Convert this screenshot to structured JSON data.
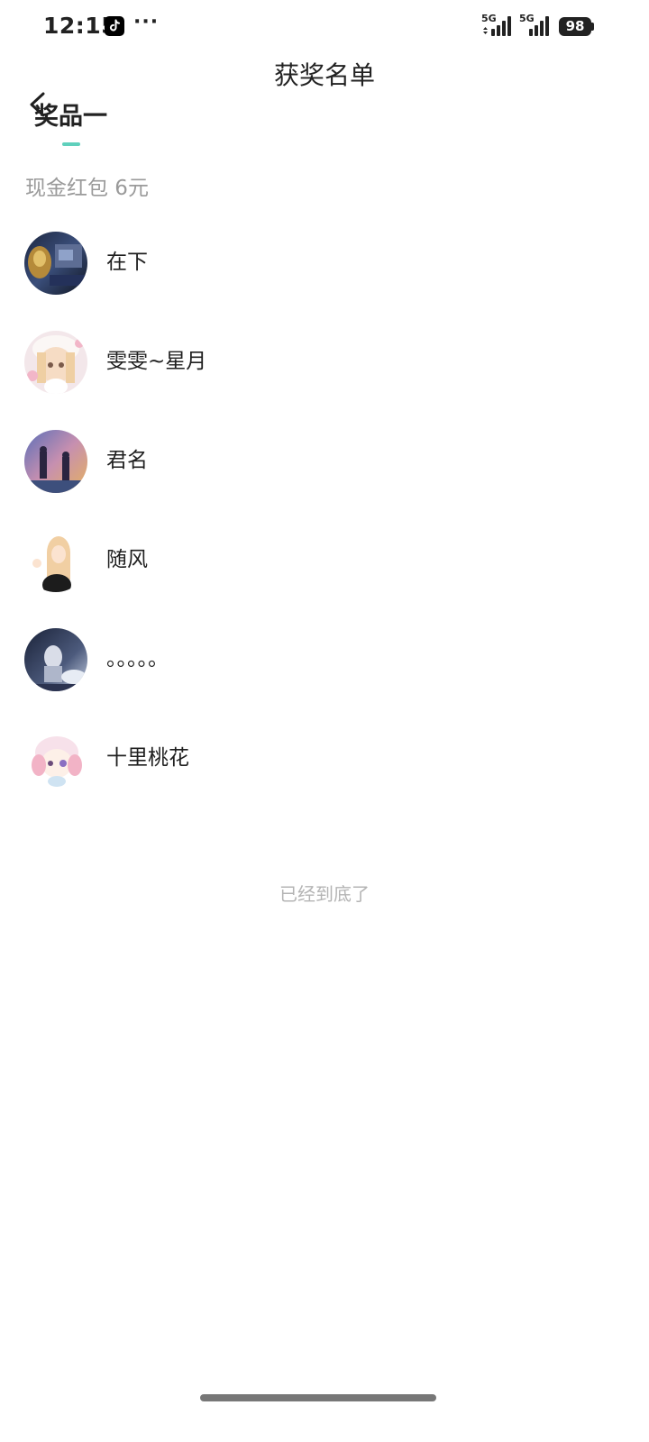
{
  "status_bar": {
    "time": "12:15",
    "more": "···",
    "network_1": "5G",
    "network_2": "5G",
    "battery": "98",
    "icons": [
      "tiktok-icon",
      "signal-icon",
      "signal-icon",
      "battery-icon"
    ]
  },
  "header": {
    "title": "获奖名单",
    "back_icon": "chevron-left-icon"
  },
  "tab": {
    "label": "奖品一",
    "indicator_color": "#5fd0bc"
  },
  "prize": {
    "description": "现金红包 6元"
  },
  "winners": [
    {
      "name": "在下",
      "avatar_icon": "avatar-image"
    },
    {
      "name": "雯雯~星月",
      "avatar_icon": "avatar-image"
    },
    {
      "name": "君名",
      "avatar_icon": "avatar-image"
    },
    {
      "name": "随风",
      "avatar_icon": "avatar-image"
    },
    {
      "name": "。。。。。",
      "avatar_icon": "avatar-image"
    },
    {
      "name": "十里桃花",
      "avatar_icon": "avatar-image"
    }
  ],
  "footer": {
    "end_text": "已经到底了"
  },
  "colors": {
    "accent": "#5fd0bc",
    "muted_text": "#9a9a9a",
    "end_text": "#b4b4b4"
  }
}
